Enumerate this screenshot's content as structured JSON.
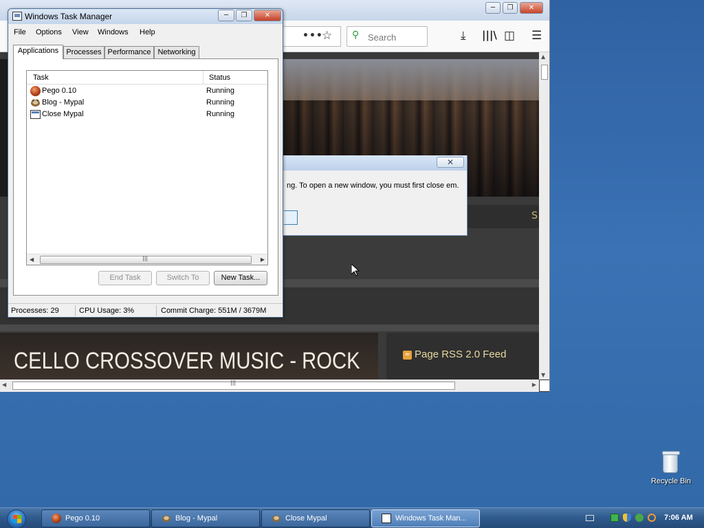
{
  "browser": {
    "search_placeholder": "Search",
    "site_title": "CELLO CROSSOVER MUSIC - ROCK",
    "rss_label": "Page RSS 2.0 Feed"
  },
  "alert": {
    "message": "ng. To open a new window, you must first close em."
  },
  "task_manager": {
    "title": "Windows Task Manager",
    "menu": [
      "File",
      "Options",
      "View",
      "Windows",
      "Help"
    ],
    "tabs": [
      "Applications",
      "Processes",
      "Performance",
      "Networking"
    ],
    "active_tab": "Applications",
    "columns": [
      "Task",
      "Status"
    ],
    "tasks": [
      {
        "name": "Pego 0.10",
        "status": "Running",
        "icon": "pego-icon"
      },
      {
        "name": "Blog - Mypal",
        "status": "Running",
        "icon": "mypal-icon"
      },
      {
        "name": "Close Mypal",
        "status": "Running",
        "icon": "window-icon"
      }
    ],
    "buttons": {
      "end_task": "End Task",
      "switch_to": "Switch To",
      "new_task": "New Task..."
    },
    "status": {
      "processes": "Processes: 29",
      "cpu": "CPU Usage: 3%",
      "commit": "Commit Charge: 551M / 3679M"
    }
  },
  "desktop": {
    "recycle_bin": "Recycle Bin"
  },
  "taskbar": {
    "items": [
      {
        "label": "Pego 0.10",
        "icon": "pego-icon"
      },
      {
        "label": "Blog - Mypal",
        "icon": "mypal-icon"
      },
      {
        "label": "Close Mypal",
        "icon": "mypal-icon"
      },
      {
        "label": "Windows Task Man...",
        "icon": "task-manager-icon"
      }
    ],
    "clock": "7:06 AM"
  },
  "colors": {
    "desktop": "#3a6ea5",
    "site_title": "#f2ece1",
    "rss_text": "#e8d9a0",
    "taskbar": "#2f5a8c"
  }
}
